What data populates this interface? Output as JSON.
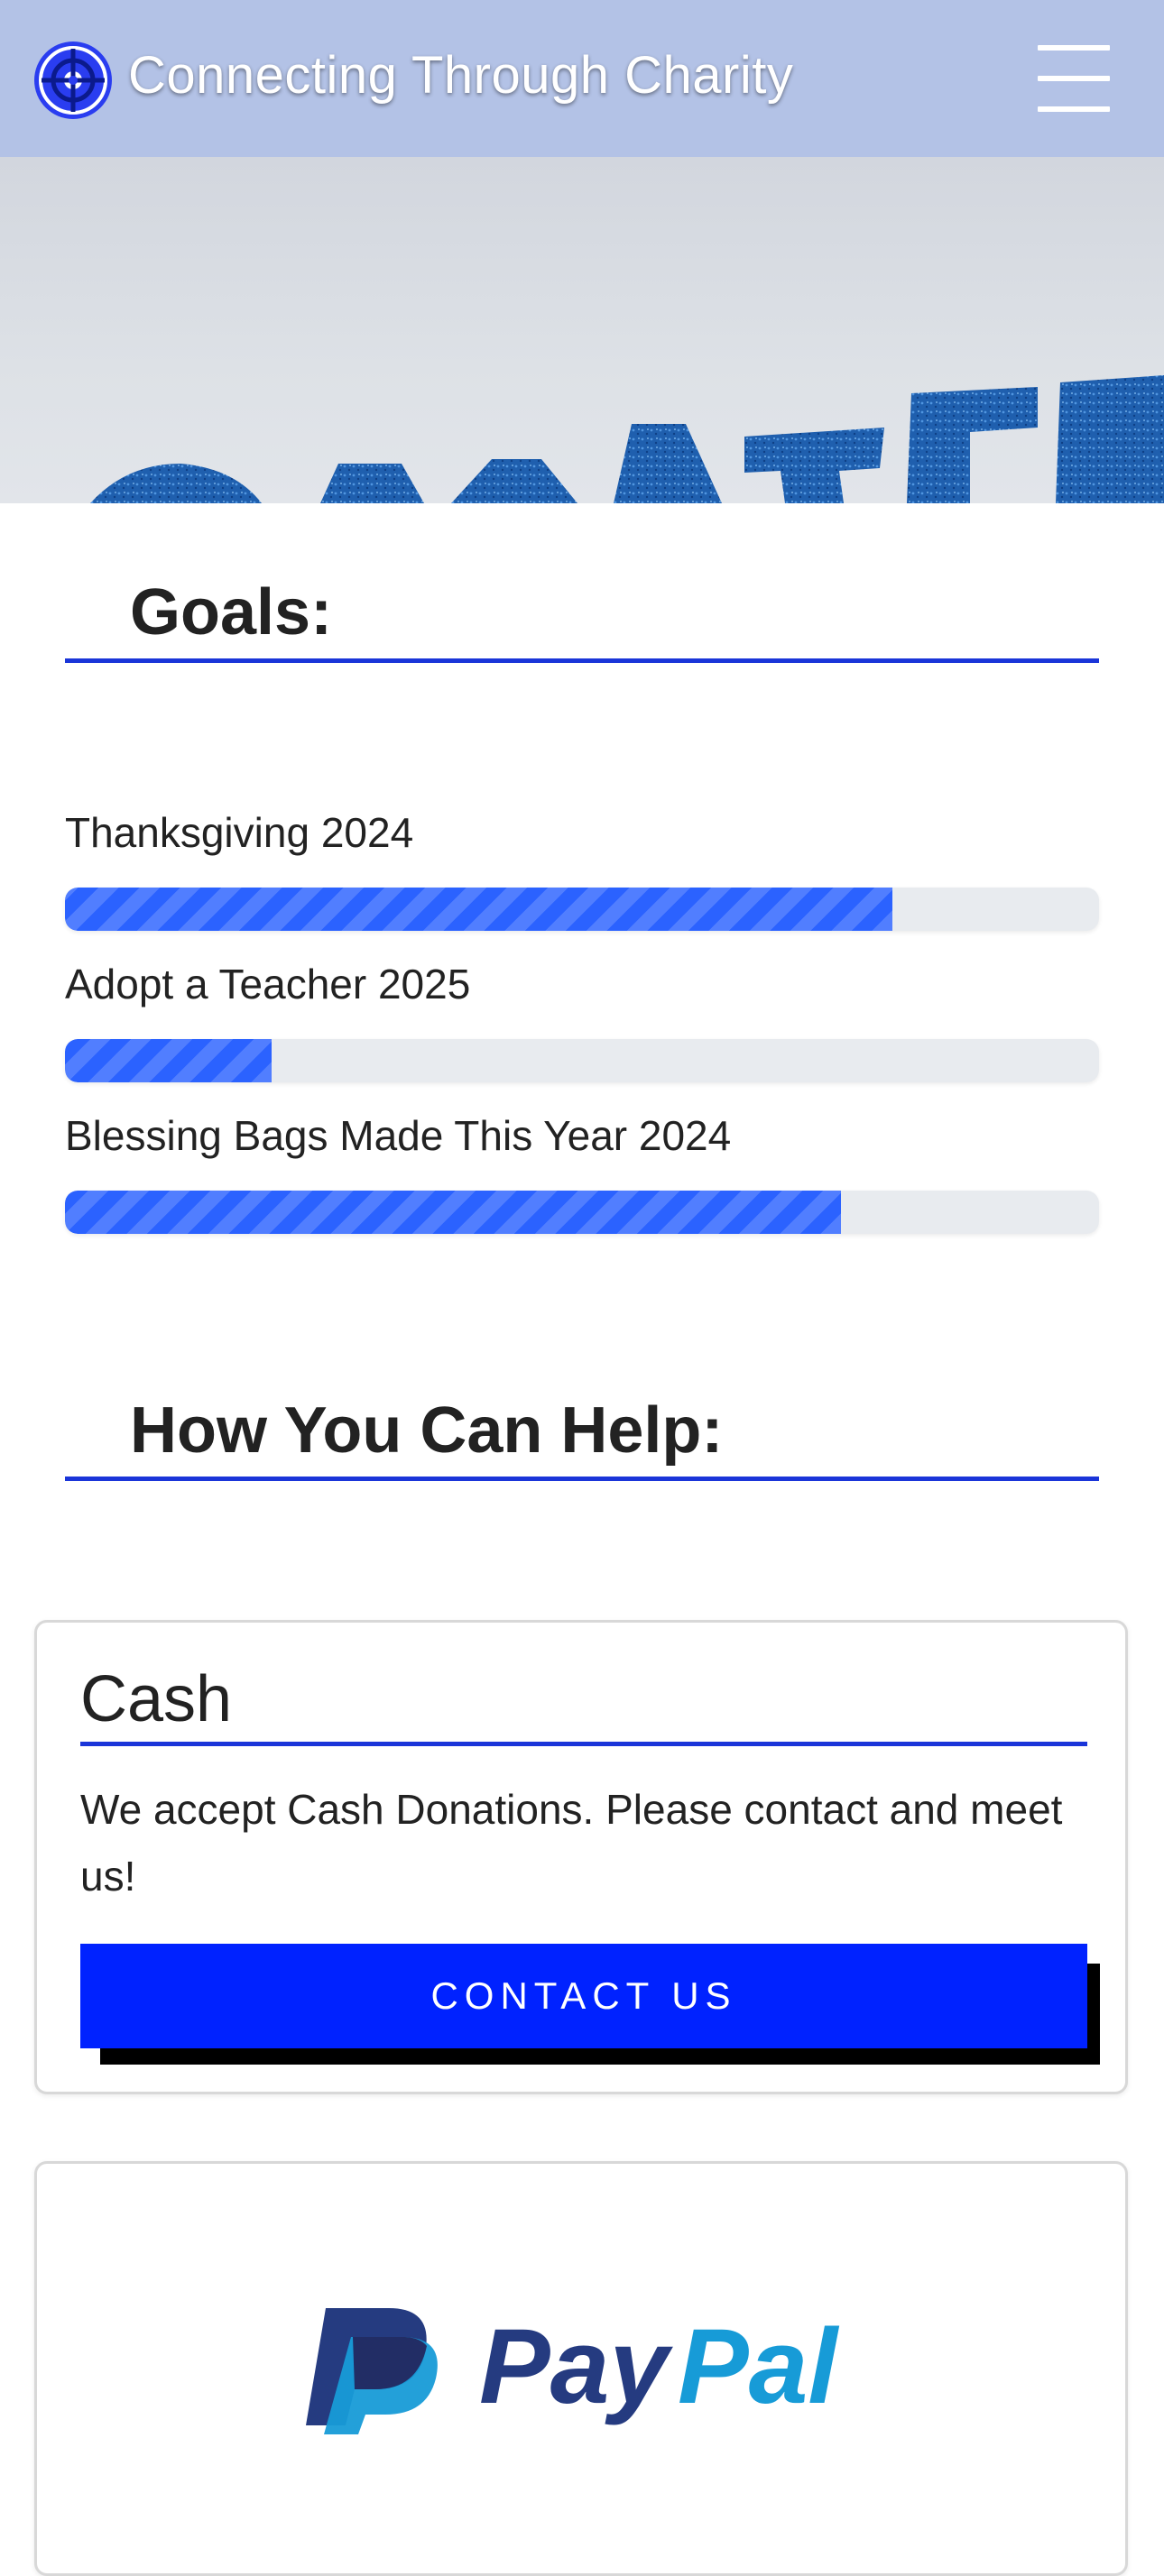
{
  "navbar": {
    "brand": "Connecting Through Charity",
    "logo_icon": "crosshair-globe-icon",
    "menu_icon": "hamburger-menu-icon",
    "bg_color": "#b3c2e6"
  },
  "hero": {
    "image_text": "DONATE",
    "text_color": "#1f5fae"
  },
  "goals": {
    "heading": "Goals:",
    "items": [
      {
        "label": "Thanksgiving 2024",
        "progress": 0.8
      },
      {
        "label": "Adopt a Teacher 2025",
        "progress": 0.2
      },
      {
        "label": "Blessing Bags Made This Year 2024",
        "progress": 0.75
      }
    ],
    "bar_color": "#2b62ff"
  },
  "help": {
    "heading": "How You Can Help:",
    "cash": {
      "title": "Cash",
      "text": "We accept Cash Donations. Please contact and meet us!",
      "button": "CONTACT US",
      "button_color": "#0022ff"
    },
    "paypal": {
      "logo_text_pay": "Pay",
      "logo_text_pal": "Pal",
      "dark_blue": "#253b80",
      "light_blue": "#179bd7"
    }
  },
  "accent_color": "#1a35d9"
}
